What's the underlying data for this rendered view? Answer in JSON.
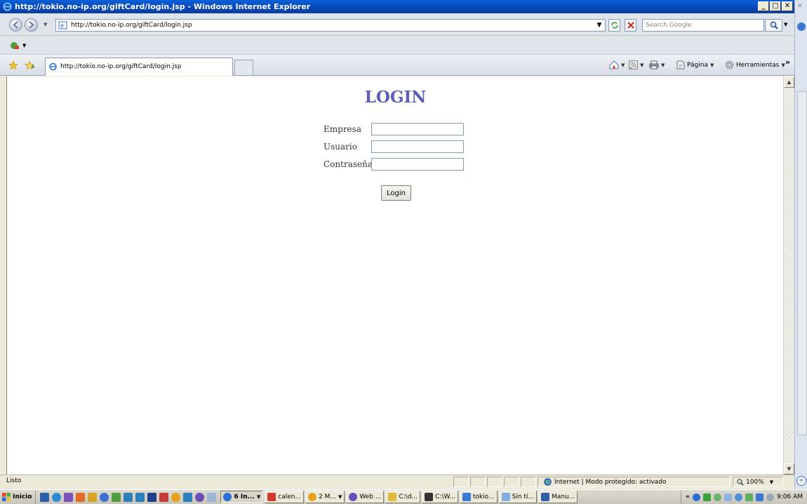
{
  "window": {
    "title": "http://tokio.no-ip.org/giftCard/login.jsp - Windows Internet Explorer",
    "controls": [
      "minimize",
      "maximize",
      "close"
    ]
  },
  "address_bar": {
    "url": "http://tokio.no-ip.org/giftCard/login.jsp",
    "search_placeholder": "Search Google"
  },
  "tabs": [
    {
      "label": "http://tokio.no-ip.org/giftCard/login.jsp",
      "active": true
    }
  ],
  "command_bar": {
    "page_label": "Página",
    "tools_label": "Herramientas"
  },
  "page": {
    "title": "LOGIN",
    "fields": [
      {
        "label": "Empresa",
        "value": ""
      },
      {
        "label": "Usuario",
        "value": ""
      },
      {
        "label": "Contraseña",
        "value": ""
      }
    ],
    "submit_label": "Login"
  },
  "status_bar": {
    "status_text": "Listo",
    "zone_text": "Internet | Modo protegido: activado",
    "zoom": "100%"
  },
  "taskbar": {
    "start_label": "Inicio",
    "tasks": [
      {
        "label": "6 In...",
        "color": "#2a6fd6",
        "active": true
      },
      {
        "label": "calen...",
        "color": "#d33b2c"
      },
      {
        "label": "2 M...",
        "color": "#e8a020"
      },
      {
        "label": "Web ...",
        "color": "#6a4fb8"
      },
      {
        "label": "C:\\d...",
        "color": "#e2b93b"
      },
      {
        "label": "C:\\W...",
        "color": "#333333"
      },
      {
        "label": "tokio...",
        "color": "#3a7bd5"
      },
      {
        "label": "Sin tí...",
        "color": "#7fb0e0"
      },
      {
        "label": "Manu...",
        "color": "#2e5fa8"
      }
    ],
    "clock": "9:06 AM"
  }
}
